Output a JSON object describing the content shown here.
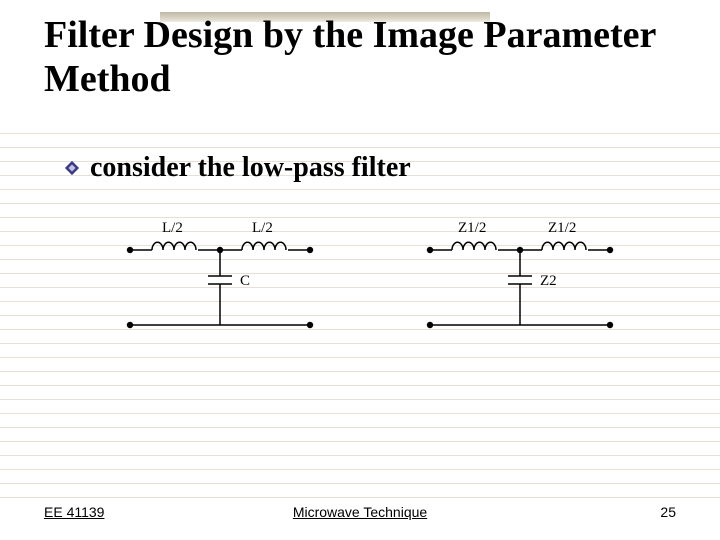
{
  "title": "Filter Design by the Image Parameter Method",
  "bullet": "consider the low-pass filter",
  "circuit_left": {
    "ind1": "L/2",
    "ind2": "L/2",
    "cap": "C"
  },
  "circuit_right": {
    "ind1": "Z1/2",
    "ind2": "Z1/2",
    "cap": "Z2"
  },
  "footer": {
    "left": "EE 41139",
    "center": "Microwave Technique",
    "right": "25"
  }
}
